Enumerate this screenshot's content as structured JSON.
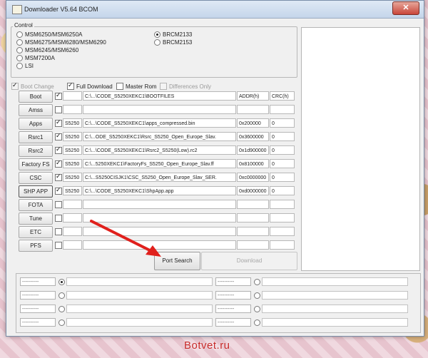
{
  "window": {
    "title": "Downloader V5.64 BCOM"
  },
  "control": {
    "label": "Control",
    "radios_left": [
      {
        "label": "MSM6250/MSM6250A",
        "selected": false
      },
      {
        "label": "MSM6275/MSM6280/MSM6290",
        "selected": false
      },
      {
        "label": "MSM6245/MSM6260",
        "selected": false
      },
      {
        "label": "MSM7200A",
        "selected": false
      },
      {
        "label": "LSI",
        "selected": false
      }
    ],
    "radios_right": [
      {
        "label": "BRCM2133",
        "selected": true
      },
      {
        "label": "BRCM2153",
        "selected": false
      }
    ]
  },
  "options": {
    "boot_change": "Boot Change",
    "full_download": "Full Download",
    "master_rom": "Master Rom",
    "differences_only": "Differences Only"
  },
  "table": {
    "addr_header": "ADDR(h)",
    "crc_header": "CRC(h)",
    "rows": [
      {
        "button": "Boot",
        "checked": true,
        "model": "",
        "path": "C:\\...\\CODE_S5250XEKC1\\BOOTFILES",
        "addr": "",
        "crc": ""
      },
      {
        "button": "Amss",
        "checked": false,
        "model": "",
        "path": "",
        "addr": "",
        "crc": ""
      },
      {
        "button": "Apps",
        "checked": true,
        "model": "S5250",
        "path": "C:\\...\\CODE_S5250XEKC1\\apps_compressed.bin",
        "addr": "0x200000",
        "crc": "0"
      },
      {
        "button": "Rsrc1",
        "checked": true,
        "model": "S5250",
        "path": "C:\\...ODE_S5250XEKC1\\Rsrc_S5250_Open_Europe_Slav.",
        "addr": "0x3600000",
        "crc": "0"
      },
      {
        "button": "Rsrc2",
        "checked": true,
        "model": "S5250",
        "path": "C:\\...\\CODE_S5250XEKC1\\Rsrc2_S5250(Low).rc2",
        "addr": "0x1d900000",
        "crc": "0"
      },
      {
        "button": "Factory FS",
        "checked": true,
        "model": "S5250",
        "path": "C:\\...5250XEKC1\\FactoryFs_S5250_Open_Europe_Slav.ff",
        "addr": "0x8100000",
        "crc": "0"
      },
      {
        "button": "CSC",
        "checked": true,
        "model": "S5250",
        "path": "C:\\...S5250CISJK1\\CSC_S5250_Open_Europe_Slav_SER.",
        "addr": "0xc0000000",
        "crc": "0"
      },
      {
        "button": "SHP APP",
        "checked": true,
        "model": "S5250",
        "path": "C:\\...\\CODE_S5250XEKC1\\ShpApp.app",
        "addr": "0xd0000000",
        "crc": "0"
      },
      {
        "button": "FOTA",
        "checked": false,
        "model": "",
        "path": "",
        "addr": "",
        "crc": ""
      },
      {
        "button": "Tune",
        "checked": false,
        "model": "",
        "path": "",
        "addr": "",
        "crc": ""
      },
      {
        "button": "ETC",
        "checked": false,
        "model": "",
        "path": "",
        "addr": "",
        "crc": ""
      },
      {
        "button": "PFS",
        "checked": false,
        "model": "",
        "path": "",
        "addr": "",
        "crc": ""
      }
    ]
  },
  "actions": {
    "port_search": "Port Search",
    "download": "Download"
  },
  "ports": {
    "left": [
      {
        "label": "----------",
        "selected": true
      },
      {
        "label": "----------",
        "selected": false
      },
      {
        "label": "----------",
        "selected": false
      },
      {
        "label": "----------",
        "selected": false
      }
    ],
    "right": [
      {
        "label": "----------",
        "selected": false
      },
      {
        "label": "----------",
        "selected": false
      },
      {
        "label": "----------",
        "selected": false
      },
      {
        "label": "----------",
        "selected": false
      }
    ]
  },
  "watermark": "Botvet.ru",
  "colors": {
    "annotation_arrow": "#e0201c",
    "watermark": "#c62828"
  }
}
